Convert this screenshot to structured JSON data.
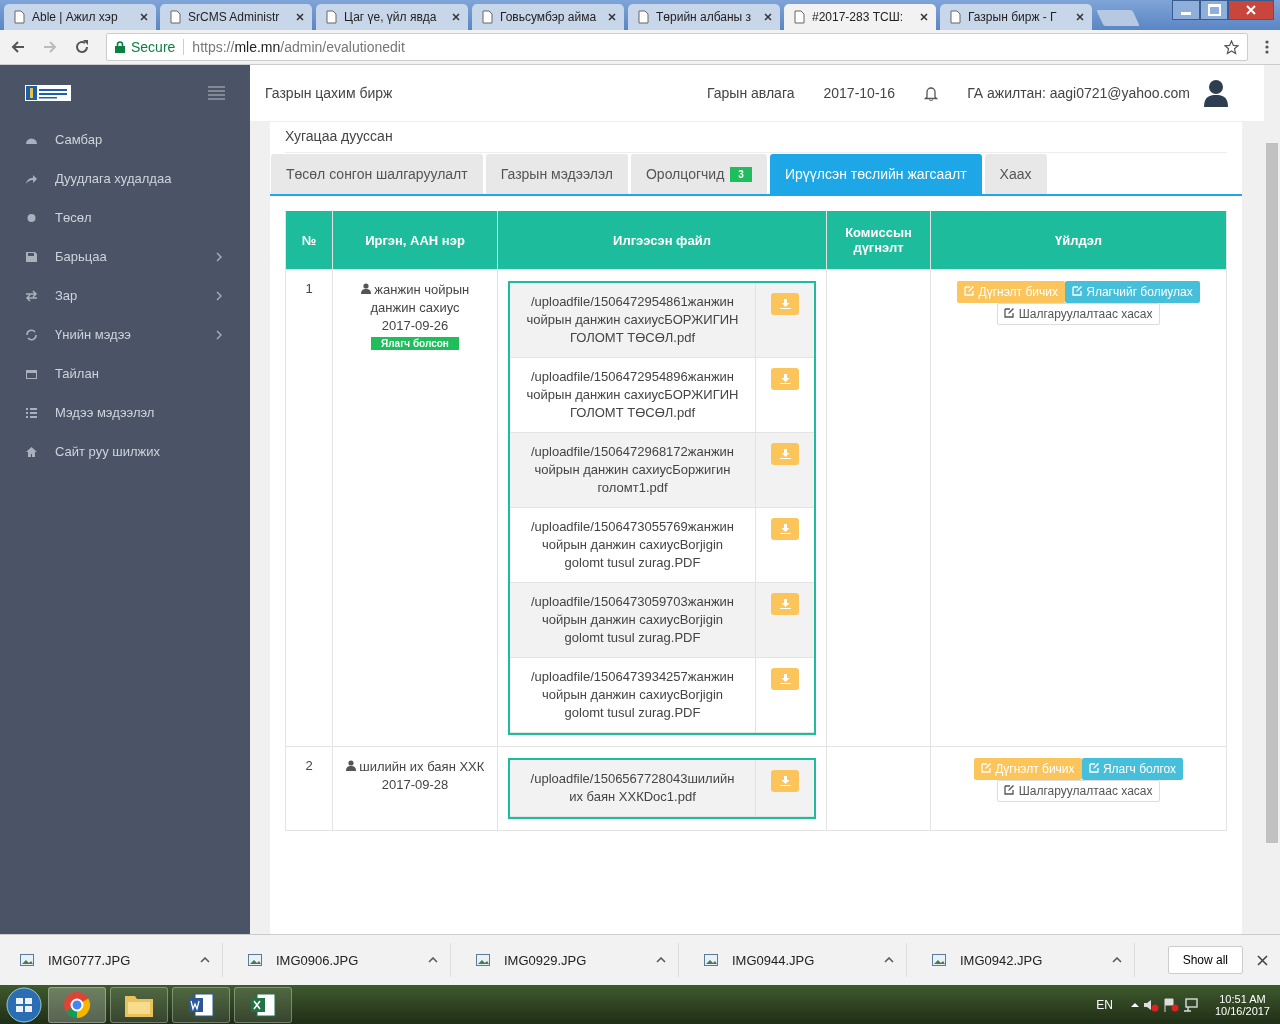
{
  "browser": {
    "tabs": [
      {
        "title": "Able | Ажил хэр",
        "selected": false
      },
      {
        "title": "SrCMS Administr",
        "selected": false
      },
      {
        "title": "Цаг үе, үйл явда",
        "selected": false
      },
      {
        "title": "Говьсумбэр айма",
        "selected": false
      },
      {
        "title": "Төрийн албаны з",
        "selected": false
      },
      {
        "title": "#2017-283 ТСШ:",
        "selected": true
      },
      {
        "title": "Газрын бирж - Г",
        "selected": false
      }
    ],
    "secure_label": "Secure",
    "url_scheme": "https://",
    "url_host": "mle.mn",
    "url_path": "/admin/evalutionedit"
  },
  "sidebar": {
    "items": [
      {
        "label": "Самбар",
        "has_submenu": false
      },
      {
        "label": "Дуудлага худалдаа",
        "has_submenu": false
      },
      {
        "label": "Төсөл",
        "has_submenu": false
      },
      {
        "label": "Барьцаа",
        "has_submenu": true
      },
      {
        "label": "Зар",
        "has_submenu": true
      },
      {
        "label": "Үнийн мэдээ",
        "has_submenu": true
      },
      {
        "label": "Тайлан",
        "has_submenu": false
      },
      {
        "label": "Мэдээ мэдээлэл",
        "has_submenu": false
      },
      {
        "label": "Сайт руу шилжих",
        "has_submenu": false
      }
    ]
  },
  "header": {
    "title": "Газрын цахим бирж",
    "link": "Гарын авлага",
    "date": "2017-10-16",
    "user": "ГА ажилтан: aagi0721@yahoo.com"
  },
  "status": "Хугацаа дууссан",
  "tabs": [
    {
      "label": "Төсөл сонгон шалгаруулалт",
      "selected": false
    },
    {
      "label": "Газрын мэдээлэл",
      "selected": false
    },
    {
      "label": "Оролцогчид",
      "badge": "3",
      "selected": false
    },
    {
      "label": "Ирүүлсэн төслийн жагсаалт",
      "selected": true
    },
    {
      "label": "Хаах",
      "selected": false
    }
  ],
  "table": {
    "columns": [
      "№",
      "Иргэн, ААН нэр",
      "Илгээсэн файл",
      "Комиссын дүгнэлт",
      "Үйлдэл"
    ],
    "rows": [
      {
        "number": "1",
        "name": "жанжин чойрын данжин сахиус",
        "date": "2017-09-26",
        "badge": "Ялагч болсон",
        "files": [
          "/uploadfile/1506472954861жанжин чойрын данжин сахиусБОРЖИГИН ГОЛОМТ ТӨСӨЛ.pdf",
          "/uploadfile/1506472954896жанжин чойрын данжин сахиусБОРЖИГИН ГОЛОМТ ТӨСӨЛ.pdf",
          "/uploadfile/1506472968172жанжин чойрын данжин сахиусБоржигин голомт1.pdf",
          "/uploadfile/1506473055769жанжин чойрын данжин сахиусBorjigin golomt tusul zurag.PDF",
          "/uploadfile/1506473059703жанжин чойрын данжин сахиусBorjigin golomt tusul zurag.PDF",
          "/uploadfile/1506473934257жанжин чойрын данжин сахиусBorjigin golomt tusul zurag.PDF"
        ],
        "actions": [
          {
            "label": "Дүгнэлт бичих",
            "kind": "warning"
          },
          {
            "label": "Ялагчийг болиулах",
            "kind": "info"
          },
          {
            "label": "Шалгаруулалтаас хасах",
            "kind": "default"
          }
        ]
      },
      {
        "number": "2",
        "name": "шилийн их баян ХХК",
        "date": "2017-09-28",
        "files": [
          "/uploadfile/1506567728043шилийн их баян ХХКDoc1.pdf"
        ],
        "actions": [
          {
            "label": "Дүгнэлт бичих",
            "kind": "warning"
          },
          {
            "label": "Ялагч болгох",
            "kind": "info"
          },
          {
            "label": "Шалгаруулалтаас хасах",
            "kind": "default"
          }
        ]
      }
    ]
  },
  "downloads": {
    "files": [
      "IMG0777.JPG",
      "IMG0906.JPG",
      "IMG0929.JPG",
      "IMG0944.JPG",
      "IMG0942.JPG"
    ],
    "show_all": "Show all"
  },
  "taskbar": {
    "language": "EN",
    "time": "10:51 AM",
    "date": "10/16/2017"
  }
}
